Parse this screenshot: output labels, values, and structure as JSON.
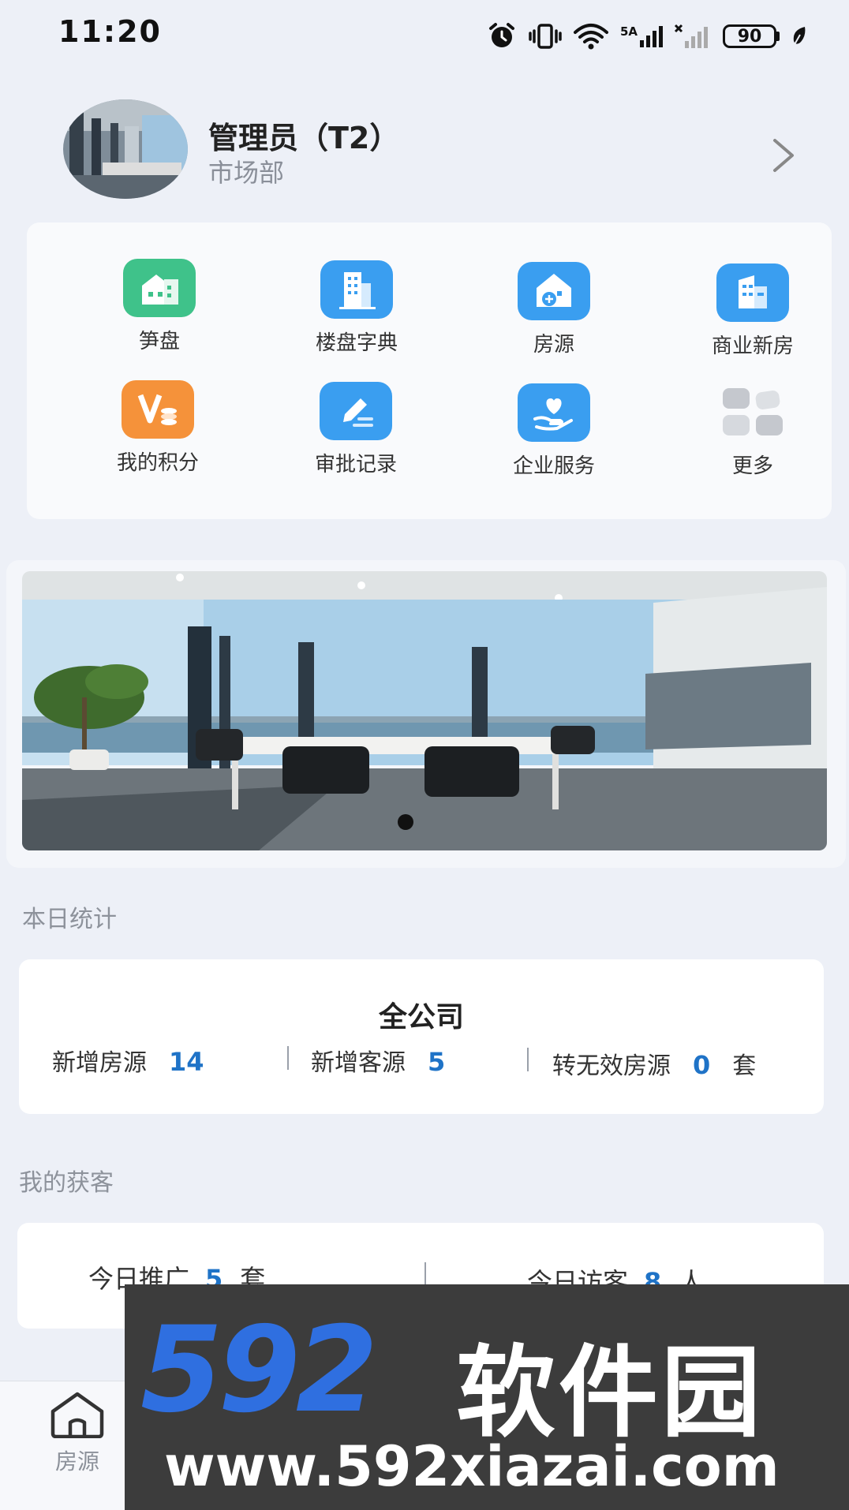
{
  "status": {
    "time": "11:20",
    "battery": "90",
    "network": "5A"
  },
  "profile": {
    "name": "管理员（T2）",
    "department": "市场部"
  },
  "grid": [
    {
      "label": "笋盘",
      "icon": "house-icon",
      "color": "#3fc28a"
    },
    {
      "label": "楼盘字典",
      "icon": "building-icon",
      "color": "#3a9ef0"
    },
    {
      "label": "房源",
      "icon": "house-add-icon",
      "color": "#3a9ef0"
    },
    {
      "label": "商业新房",
      "icon": "office-icon",
      "color": "#3a9ef0"
    },
    {
      "label": "我的积分",
      "icon": "points-icon",
      "color": "#f5923a"
    },
    {
      "label": "审批记录",
      "icon": "approval-icon",
      "color": "#3a9ef0"
    },
    {
      "label": "企业服务",
      "icon": "service-icon",
      "color": "#3a9ef0"
    },
    {
      "label": "更多",
      "icon": "more-icon",
      "color": "#c9ccd2"
    }
  ],
  "daily": {
    "title": "本日统计",
    "company": "全公司",
    "stats": [
      {
        "label": "新增房源",
        "value": "14"
      },
      {
        "label": "新增客源",
        "value": "5"
      },
      {
        "label": "转无效房源",
        "value": "0",
        "unit": "套"
      }
    ]
  },
  "leads": {
    "title": "我的获客",
    "items": [
      {
        "label": "今日推广",
        "value": "5",
        "unit": "套"
      },
      {
        "label": "今日访客",
        "value": "8",
        "unit": "人"
      }
    ]
  },
  "nav": {
    "home_label": "房源"
  },
  "watermark": {
    "brand_num": "592",
    "brand_cn": "软件园",
    "url": "www.592xiazai.com"
  }
}
